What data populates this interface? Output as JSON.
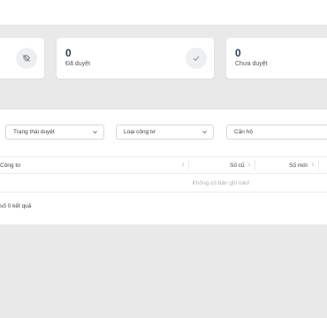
{
  "stats": [
    {
      "value": "0",
      "label": "Đã duyệt",
      "icon": "check-icon"
    },
    {
      "value": "0",
      "label": "Chưa duyệt",
      "icon": "minus-icon"
    }
  ],
  "first_card_icon": "tag-off-icon",
  "filters": {
    "status_placeholder": "Trạng thái duyệt",
    "meter_type_placeholder": "Loại công tơ",
    "apartment_placeholder": "Căn hộ"
  },
  "table": {
    "columns": [
      "Công tơ",
      "Số cũ",
      "Số mới"
    ],
    "empty_text": "Không có bản ghi nào!"
  },
  "footer": {
    "result_text": "số 0 kết quả"
  }
}
